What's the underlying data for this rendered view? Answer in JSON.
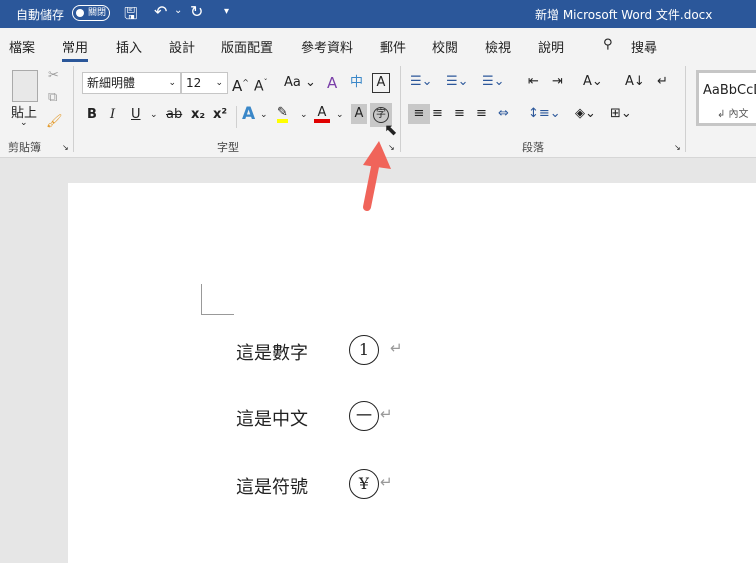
{
  "titlebar": {
    "autosave": "自動儲存",
    "toggle": "關閉",
    "doc_title": "新增 Microsoft Word 文件.docx"
  },
  "tabs": [
    "檔案",
    "常用",
    "插入",
    "設計",
    "版面配置",
    "參考資料",
    "郵件",
    "校閱",
    "檢視",
    "說明"
  ],
  "search": "搜尋",
  "clipboard": {
    "paste": "貼上",
    "group": "剪貼簿"
  },
  "font": {
    "name": "新細明體",
    "size": "12",
    "case": "Aa",
    "bold": "B",
    "italic": "I",
    "underline": "U",
    "strike": "ab",
    "sub": "x₂",
    "sup": "x²",
    "group": "字型",
    "enclose": "字",
    "shade": "A",
    "border_char": "A",
    "phonetic": "中"
  },
  "paragraph": {
    "group": "段落"
  },
  "styles": {
    "preview": "AaBbCcD",
    "name": "↲ 內文"
  },
  "document": {
    "lines": [
      {
        "text": "這是數字",
        "symbol": "1"
      },
      {
        "text": "這是中文",
        "symbol": "一"
      },
      {
        "text": "這是符號",
        "symbol": "¥"
      }
    ],
    "return_mark": "↵"
  },
  "colors": {
    "accent": "#2b579a",
    "arrow": "#f0645a",
    "highlight": "#ffff00",
    "font_color": "#e00000"
  }
}
